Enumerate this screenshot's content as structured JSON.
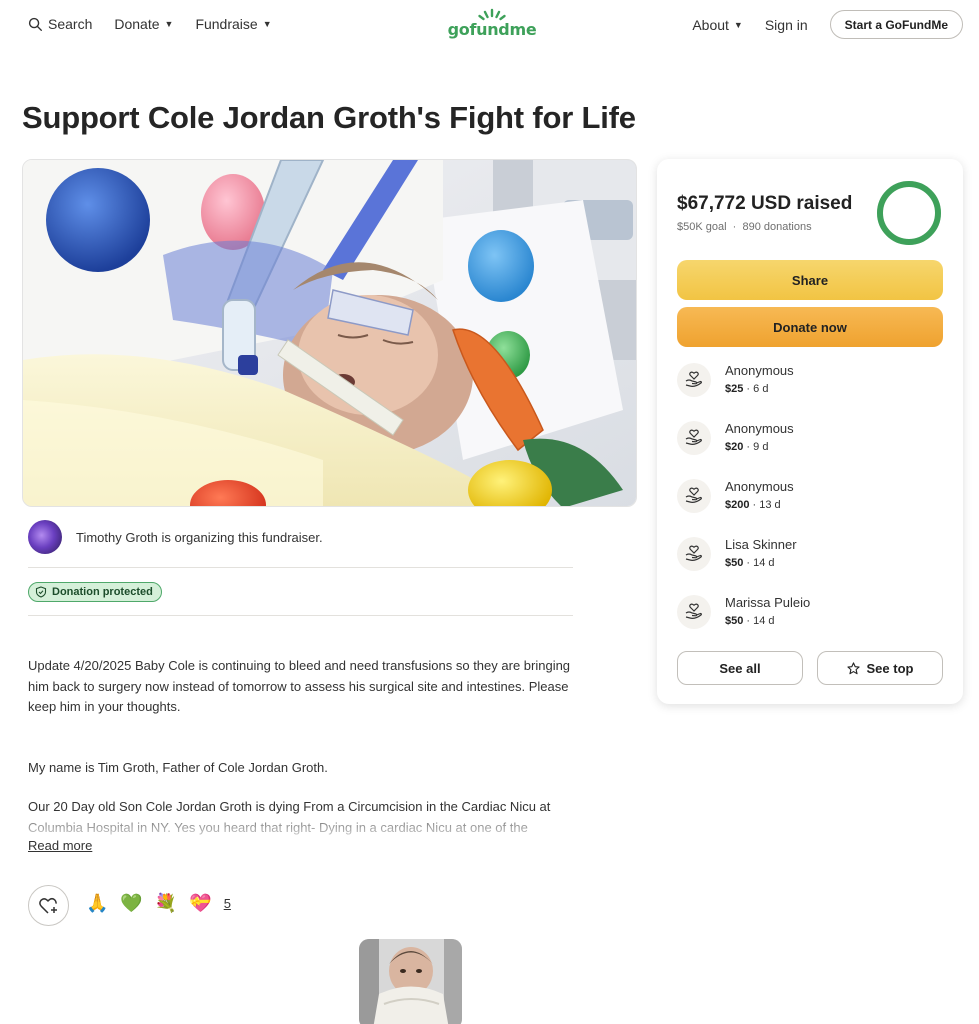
{
  "header": {
    "search_label": "Search",
    "donate_label": "Donate",
    "fundraise_label": "Fundraise",
    "logo_text": "gofundme",
    "about_label": "About",
    "signin_label": "Sign in",
    "start_label": "Start a GoFundMe"
  },
  "title": "Support Cole Jordan Groth's Fight for Life",
  "organizer": {
    "text": "Timothy Groth is organizing this fundraiser."
  },
  "badge": "Donation protected",
  "story": {
    "p1": "Update 4/20/2025 Baby Cole is continuing to bleed and need transfusions so they are bringing him back to surgery now instead of tomorrow to assess his surgical site and intestines. Please keep him in your thoughts.",
    "p2": "My name is Tim Groth, Father of Cole Jordan Groth.",
    "p3": "Our 20 Day old Son Cole Jordan Groth is dying From a Circumcision in the Cardiac Nicu at Columbia Hospital in NY. Yes you heard that right- Dying in a cardiac Nicu at one of the",
    "read_more": "Read more"
  },
  "reactions": {
    "emojis": [
      "🙏",
      "💚",
      "💐",
      "💝"
    ],
    "count": "5"
  },
  "card": {
    "raised": "$67,772 USD raised",
    "goal": "$50K goal",
    "donations": "890 donations",
    "progress": 1.0,
    "share_label": "Share",
    "donate_label": "Donate now",
    "donors": [
      {
        "name": "Anonymous",
        "amount": "$25",
        "time": "6 d"
      },
      {
        "name": "Anonymous",
        "amount": "$20",
        "time": "9 d"
      },
      {
        "name": "Anonymous",
        "amount": "$200",
        "time": "13 d"
      },
      {
        "name": "Lisa Skinner",
        "amount": "$50",
        "time": "14 d"
      },
      {
        "name": "Marissa Puleio",
        "amount": "$50",
        "time": "14 d"
      }
    ],
    "see_all_label": "See all",
    "see_top_label": "See top"
  },
  "colors": {
    "brand_green": "#3ea15a",
    "share_yellow": "#f2c443",
    "donate_orange": "#efa22f",
    "badge_bg": "#d5f0d9"
  }
}
